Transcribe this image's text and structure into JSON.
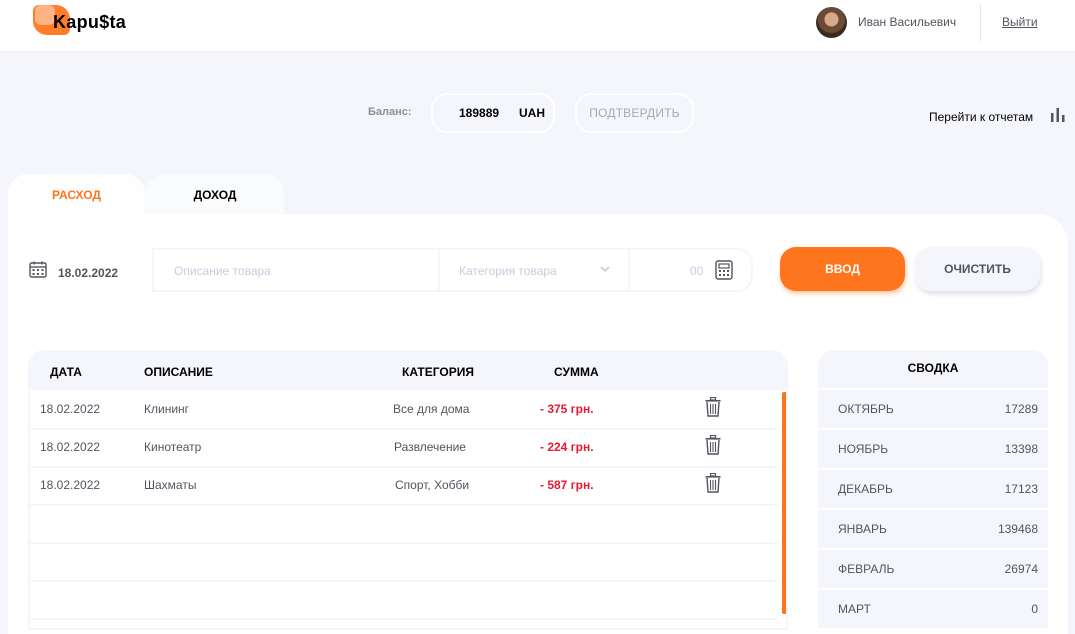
{
  "header": {
    "logo_text": "Kapu$ta",
    "user_name": "Иван Васильевич",
    "logout_label": "Выйти"
  },
  "balance": {
    "label": "Баланс:",
    "value": "189889",
    "currency": "UAH",
    "confirm_label": "ПОДТВЕРДИТЬ"
  },
  "reports_link": "Перейти к отчетам",
  "tabs": [
    {
      "label": "РАСХОД",
      "active": true
    },
    {
      "label": "ДОХОД",
      "active": false
    }
  ],
  "form": {
    "date": "18.02.2022",
    "description_placeholder": "Описание товара",
    "category_placeholder": "Категория товара",
    "amount_placeholder": "00",
    "enter_label": "ВВОД",
    "clear_label": "ОЧИСТИТЬ"
  },
  "table": {
    "headers": [
      "ДАТА",
      "ОПИСАНИЕ",
      "КАТЕГОРИЯ",
      "СУММА"
    ],
    "rows": [
      {
        "date": "18.02.2022",
        "description": "Клининг",
        "category": "Все для дома",
        "amount": "- 375 грн."
      },
      {
        "date": "18.02.2022",
        "description": "Кинотеатр",
        "category": "Развлечение",
        "amount": "- 224 грн."
      },
      {
        "date": "18.02.2022",
        "description": "Шахматы",
        "category": "Спорт, Хобби",
        "amount": "- 587 грн."
      }
    ]
  },
  "summary": {
    "title": "СВОДКА",
    "months": [
      {
        "month": "ОКТЯБРЬ",
        "value": "17289"
      },
      {
        "month": "НОЯБРЬ",
        "value": "13398"
      },
      {
        "month": "ДЕКАБРЬ",
        "value": "17123"
      },
      {
        "month": "ЯНВАРЬ",
        "value": "139468"
      },
      {
        "month": "ФЕВРАЛЬ",
        "value": "26974"
      },
      {
        "month": "МАРТ",
        "value": "0"
      }
    ]
  },
  "colors": {
    "accent": "#ff751d",
    "expense": "#e7192e",
    "background": "#f5f6fb"
  }
}
